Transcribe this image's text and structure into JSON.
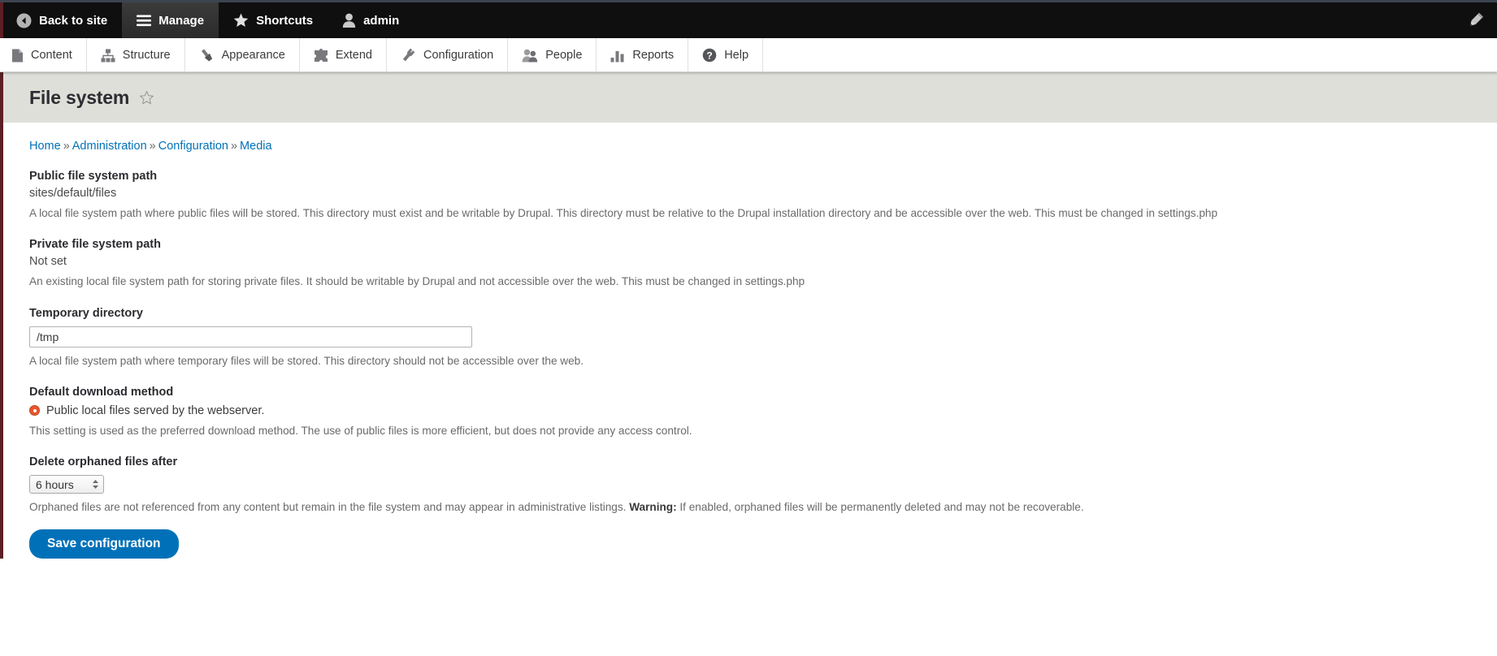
{
  "toolbar": {
    "back_to_site": "Back to site",
    "manage": "Manage",
    "shortcuts": "Shortcuts",
    "user": "admin",
    "edit_icon_name": "pencil-icon"
  },
  "menu": {
    "items": [
      {
        "label": "Content",
        "icon": "page-icon"
      },
      {
        "label": "Structure",
        "icon": "structure-icon"
      },
      {
        "label": "Appearance",
        "icon": "paintbrush-icon"
      },
      {
        "label": "Extend",
        "icon": "puzzle-icon"
      },
      {
        "label": "Configuration",
        "icon": "wrench-icon"
      },
      {
        "label": "People",
        "icon": "people-icon"
      },
      {
        "label": "Reports",
        "icon": "bar-chart-icon"
      },
      {
        "label": "Help",
        "icon": "question-icon"
      }
    ]
  },
  "page": {
    "title": "File system"
  },
  "breadcrumb": {
    "items": [
      "Home",
      "Administration",
      "Configuration",
      "Media"
    ],
    "separator": "»"
  },
  "form": {
    "public_path": {
      "label": "Public file system path",
      "value": "sites/default/files",
      "description": "A local file system path where public files will be stored. This directory must exist and be writable by Drupal. This directory must be relative to the Drupal installation directory and be accessible over the web. This must be changed in settings.php"
    },
    "private_path": {
      "label": "Private file system path",
      "value": "Not set",
      "description": "An existing local file system path for storing private files. It should be writable by Drupal and not accessible over the web. This must be changed in settings.php"
    },
    "temporary_directory": {
      "label": "Temporary directory",
      "value": "/tmp",
      "placeholder": "",
      "description": "A local file system path where temporary files will be stored. This directory should not be accessible over the web."
    },
    "download_method": {
      "label": "Default download method",
      "options": [
        "Public local files served by the webserver."
      ],
      "selected": "Public local files served by the webserver.",
      "description": "This setting is used as the preferred download method. The use of public files is more efficient, but does not provide any access control.",
      "accent_color": "#e8552d"
    },
    "delete_orphaned": {
      "label": "Delete orphaned files after",
      "selected": "6 hours",
      "options": [
        "6 hours"
      ],
      "description_before": "Orphaned files are not referenced from any content but remain in the file system and may appear in administrative listings. ",
      "warning_label": "Warning:",
      "description_after": " If enabled, orphaned files will be permanently deleted and may not be recoverable."
    },
    "save_button": "Save configuration"
  },
  "colors": {
    "link": "#0071b8",
    "toolbar_bg": "#0f0f0f",
    "title_bg": "#dfdfd9",
    "accent_stripe": "#5c1f24",
    "radio_accent": "#e8552d",
    "button_blue": "#0071b8"
  }
}
